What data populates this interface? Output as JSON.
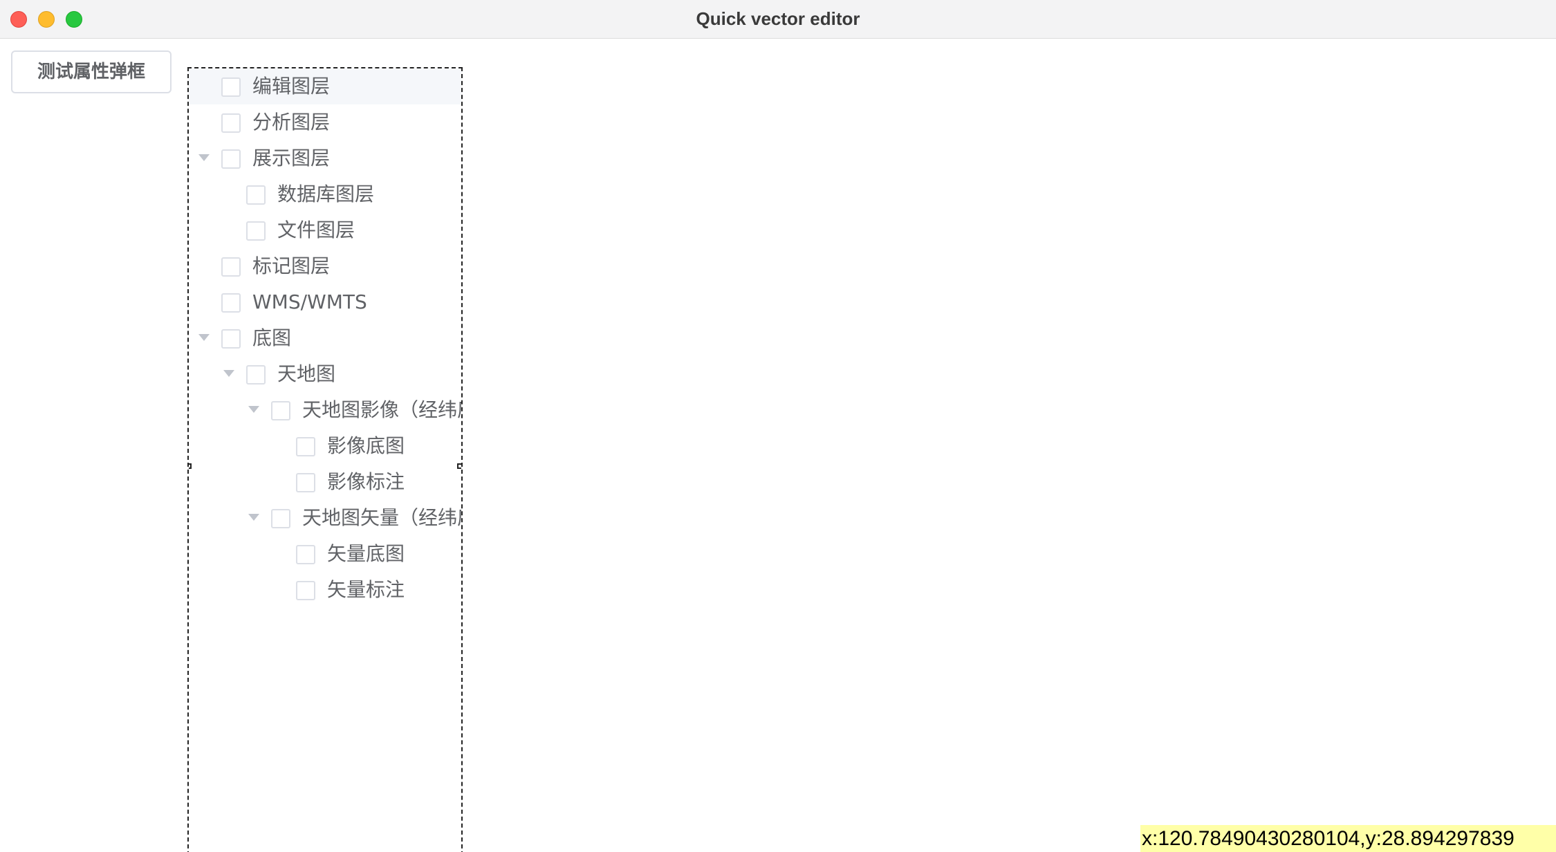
{
  "window": {
    "title": "Quick vector editor"
  },
  "toolbar": {
    "test_button_label": "测试属性弹框"
  },
  "tree": {
    "nodes": [
      {
        "label": "编辑图层"
      },
      {
        "label": "分析图层"
      },
      {
        "label": "展示图层"
      },
      {
        "label": "数据库图层"
      },
      {
        "label": "文件图层"
      },
      {
        "label": "标记图层"
      },
      {
        "label": "WMS/WMTS"
      },
      {
        "label": "底图"
      },
      {
        "label": "天地图"
      },
      {
        "label": "天地图影像（经纬度"
      },
      {
        "label": "影像底图"
      },
      {
        "label": "影像标注"
      },
      {
        "label": "天地图矢量（经纬度"
      },
      {
        "label": "矢量底图"
      },
      {
        "label": "矢量标注"
      }
    ]
  },
  "status": {
    "coordinates": "x:120.78490430280104,y:28.894297839"
  },
  "colors": {
    "coord_bg": "#ffffa8",
    "close": "#fe5f57",
    "minimize": "#febc2e",
    "maximize": "#28c840"
  }
}
